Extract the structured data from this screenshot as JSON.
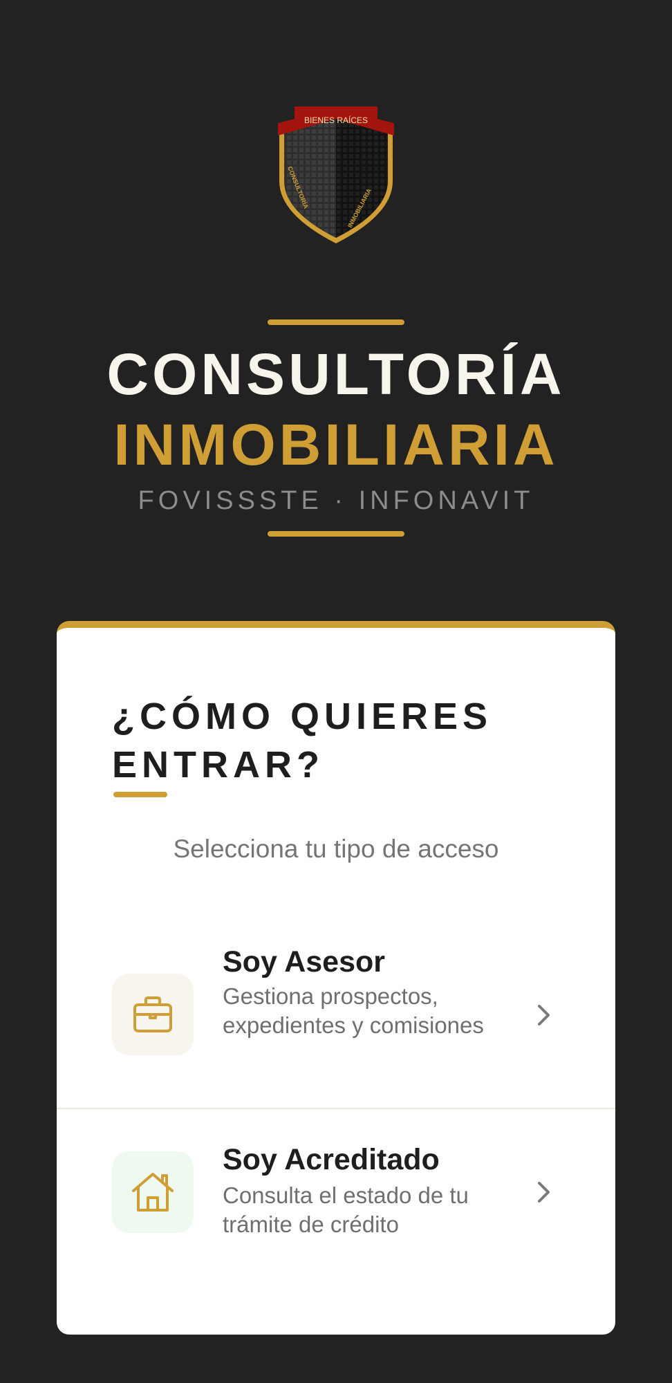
{
  "brand": {
    "logo": {
      "icon": "shield-building-logo",
      "ribbon_text": "BIENES RAÍCES",
      "left_arc_text": "CONSULTORÍA",
      "right_arc_text": "INMOBILIARIA"
    },
    "title_line1": "CONSULTORÍA",
    "title_line2": "INMOBILIARIA",
    "subtitle": "FOVISSSTE · INFONAVIT"
  },
  "card": {
    "title": "¿CÓMO QUIERES ENTRAR?",
    "subtitle": "Selecciona tu tipo de acceso",
    "options": [
      {
        "id": "asesor",
        "icon": "briefcase-icon",
        "title": "Soy Asesor",
        "description": "Gestiona prospectos, expedientes y comisiones"
      },
      {
        "id": "acreditado",
        "icon": "house-icon",
        "title": "Soy Acreditado",
        "description": "Consulta el estado de tu trámite de crédito"
      }
    ]
  },
  "colors": {
    "background": "#222223",
    "accent_gold": "#CF9E35",
    "title_light": "#F7F4EC",
    "card_background": "#FFFFFF",
    "ribbon_red": "#A3140F"
  }
}
